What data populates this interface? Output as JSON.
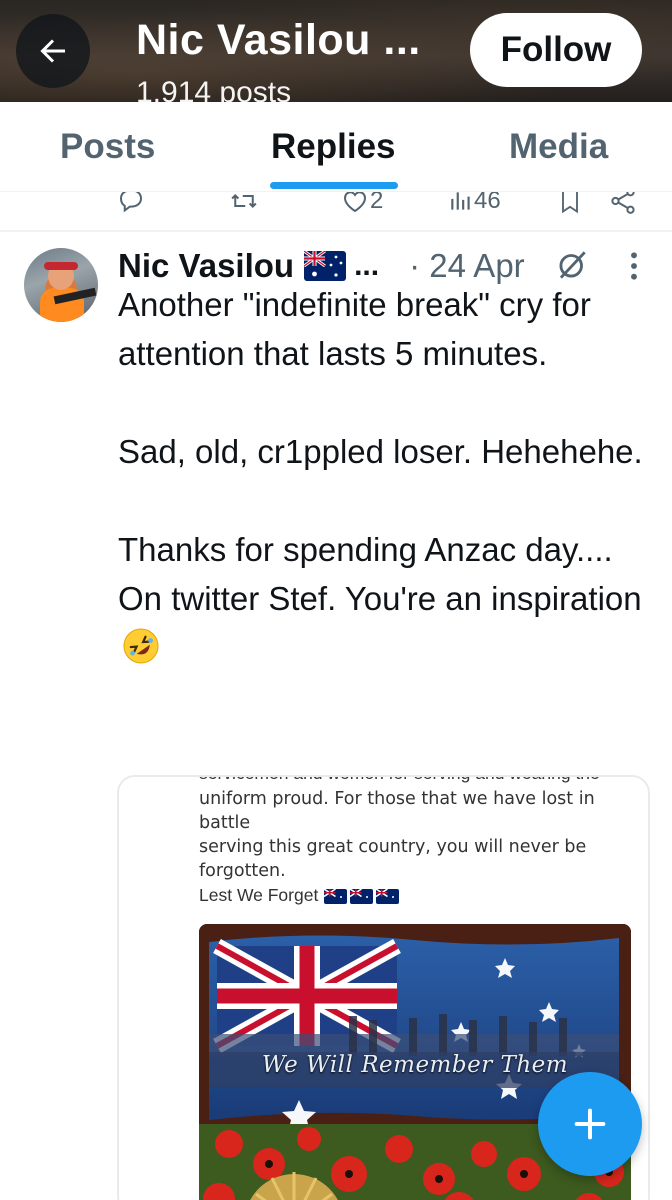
{
  "header": {
    "title": "Nic Vasilou ...",
    "subtitle": "1,914 posts",
    "follow_label": "Follow",
    "back_icon": "arrow-left-icon"
  },
  "tabs": [
    {
      "label": "Posts",
      "active": false
    },
    {
      "label": "Replies",
      "active": true
    },
    {
      "label": "Media",
      "active": false
    }
  ],
  "prev_actions": {
    "likes": "2",
    "views": "46"
  },
  "post": {
    "author": "Nic Vasilou",
    "ellipsis": "...",
    "date": "· 24 Apr",
    "paragraphs": [
      "Another \"indefinite break\" cry for attention that lasts 5 minutes.",
      "Sad, old, cr1ppled loser. Hehehehe.",
      "Thanks for spending Anzac day.... On twitter Stef. You're an inspiration"
    ]
  },
  "embed": {
    "cut_line": "servicemen and women for serving and wearing the",
    "lines": [
      "uniform proud. For those that we have lost in battle",
      "serving this great country, you will never be",
      "forgotten."
    ],
    "lest_we_forget": "Lest We Forget",
    "poster_caption": "We Will Remember Them"
  },
  "colors": {
    "accent": "#1d9bf0",
    "text": "#0f1419",
    "muted": "#536471"
  }
}
